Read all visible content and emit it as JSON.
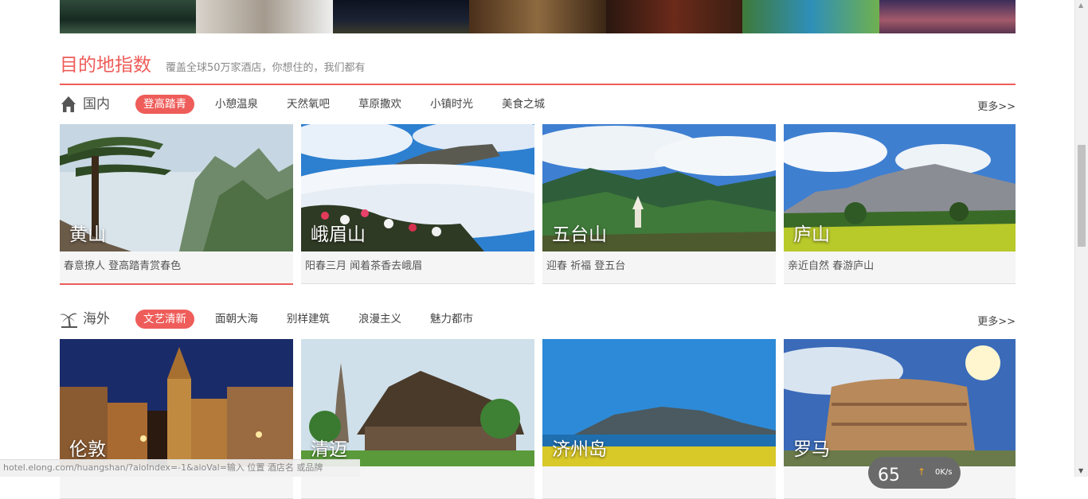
{
  "section": {
    "title": "目的地指数",
    "subtitle": "覆盖全球50万家酒店，你想住的，我们都有"
  },
  "domestic": {
    "label": "国内",
    "icon": "house-icon",
    "more": "更多>>",
    "tabs": [
      {
        "label": "登高踏青",
        "active": true
      },
      {
        "label": "小憩温泉"
      },
      {
        "label": "天然氧吧"
      },
      {
        "label": "草原撒欢"
      },
      {
        "label": "小镇时光"
      },
      {
        "label": "美食之城"
      }
    ],
    "cards": [
      {
        "name": "黄山",
        "desc": "春意撩人 登高踏青赏春色"
      },
      {
        "name": "峨眉山",
        "desc": "阳春三月 闻着茶香去峨眉"
      },
      {
        "name": "五台山",
        "desc": "迎春 祈福 登五台"
      },
      {
        "name": "庐山",
        "desc": "亲近自然 春游庐山"
      }
    ]
  },
  "overseas": {
    "label": "海外",
    "icon": "palm-tree-icon",
    "more": "更多>>",
    "tabs": [
      {
        "label": "文艺清新",
        "active": true
      },
      {
        "label": "面朝大海"
      },
      {
        "label": "别样建筑"
      },
      {
        "label": "浪漫主义"
      },
      {
        "label": "魅力都市"
      }
    ],
    "cards": [
      {
        "name": "伦敦"
      },
      {
        "name": "清迈"
      },
      {
        "name": "济州岛"
      },
      {
        "name": "罗马"
      }
    ]
  },
  "status_bar": {
    "url": "hotel.elong.com/huangshan/?aioIndex=-1&aioVal=输入 位置 酒店名 或品牌"
  },
  "speed_widget": {
    "number": "65",
    "value": "0K/s"
  },
  "colors": {
    "accent": "#ee5d5a"
  }
}
